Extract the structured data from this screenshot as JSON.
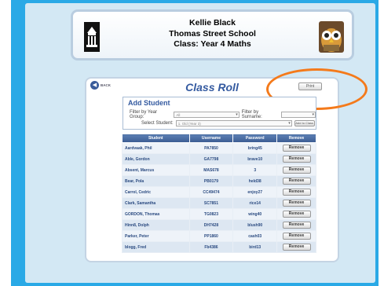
{
  "header": {
    "teacher_name": "Kellie Black",
    "school_name": "Thomas Street School",
    "class_label": "Class: Year 4 Maths"
  },
  "nav": {
    "back_label": "BACK"
  },
  "page": {
    "title": "Class Roll",
    "print_label": "Print"
  },
  "add_student": {
    "title": "Add Student",
    "filter_year_label": "Filter by Year Group:",
    "filter_year_value": "All",
    "filter_surname_label": "Filter by Surname:",
    "filter_surname_value": "",
    "select_student_label": "Select Student:",
    "select_student_value": "1. Old (Year 3)",
    "add_button_label": "Add to Class"
  },
  "table": {
    "headers": [
      "Student",
      "Username",
      "Password",
      "Remove"
    ],
    "rows": [
      {
        "student": "Aardvaak, Phil",
        "username": "PA7850",
        "password": "bring45",
        "action": "Remove"
      },
      {
        "student": "Able, Gordon",
        "username": "GA7798",
        "password": "brave10",
        "action": "Remove"
      },
      {
        "student": "Absent, Marcus",
        "username": "MAS678",
        "password": "3",
        "action": "Remove"
      },
      {
        "student": "Bear, Pola",
        "username": "PB0179",
        "password": "held38",
        "action": "Remove"
      },
      {
        "student": "Carrol, Cedric",
        "username": "CC49474",
        "password": "enjoy27",
        "action": "Remove"
      },
      {
        "student": "Clark, Samantha",
        "username": "SC7851",
        "password": "rice14",
        "action": "Remove"
      },
      {
        "student": "GORDON, Thomas",
        "username": "TG0823",
        "password": "wing40",
        "action": "Remove"
      },
      {
        "student": "Hinn8, Dolph",
        "username": "DH7428",
        "password": "blush90",
        "action": "Remove"
      },
      {
        "student": "Parker, Peter",
        "username": "PP1860",
        "password": "cash03",
        "action": "Remove"
      },
      {
        "student": "blogg, Fred",
        "username": "Fb4386",
        "password": "bird13",
        "action": "Remove"
      }
    ]
  },
  "icons": {
    "school": "school-building-icon",
    "mascot": "owl-mascot-icon",
    "back": "back-arrow-icon"
  },
  "colors": {
    "frame": "#2aa9e6",
    "accent": "#345aa0",
    "highlight_ring": "#f47a1b"
  }
}
